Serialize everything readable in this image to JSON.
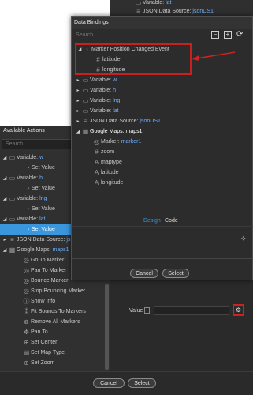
{
  "background": {
    "variable_lat": {
      "label": "Variable:",
      "name": "lat"
    },
    "json_source": {
      "label": "JSON Data Source:",
      "name": "jsonDS1"
    }
  },
  "available_actions": {
    "title": "Available Actions",
    "search_placeholder": "Search",
    "items": [
      {
        "type": "Variable:",
        "name": "w",
        "sub": "Set Value"
      },
      {
        "type": "Variable:",
        "name": "h",
        "sub": "Set Value"
      },
      {
        "type": "Variable:",
        "name": "lng",
        "sub": "Set Value"
      },
      {
        "type": "Variable:",
        "name": "lat",
        "sub": "Set Value"
      }
    ],
    "json_source": {
      "label": "JSON Data Source:",
      "name": "js"
    },
    "maps": {
      "label": "Google Maps:",
      "name": "maps1"
    },
    "map_actions": [
      "Go To Marker",
      "Pan To Marker",
      "Bounce Marker",
      "Stop Bouncing Marker",
      "Show Info",
      "Fit Bounds To Markers",
      "Remove All Markers",
      "Pan To",
      "Set Center",
      "Set Map Type",
      "Set Zoom"
    ]
  },
  "properties": {
    "value_label": "Value"
  },
  "footer": {
    "cancel": "Cancel",
    "select": "Select"
  },
  "data_bindings": {
    "title": "Data Bindings",
    "search_placeholder": "Search",
    "event": {
      "label": "Marker Position Changed Event",
      "fields": [
        "latitude",
        "longitude"
      ]
    },
    "variables": [
      {
        "label": "Variable:",
        "name": "w"
      },
      {
        "label": "Variable:",
        "name": "h"
      },
      {
        "label": "Variable:",
        "name": "lng"
      },
      {
        "label": "Variable:",
        "name": "lat"
      }
    ],
    "json_source": {
      "label": "JSON Data Source:",
      "name": "jsonDS1"
    },
    "maps": {
      "label": "Google Maps:",
      "name": "maps1",
      "marker": {
        "label": "Marker:",
        "name": "marker1"
      },
      "fields": [
        {
          "icon": "#",
          "name": "zoom"
        },
        {
          "icon": "A",
          "name": "maptype"
        },
        {
          "icon": "A",
          "name": "latitude"
        },
        {
          "icon": "A",
          "name": "longitude"
        }
      ]
    },
    "tabs": {
      "design": "Design",
      "code": "Code"
    },
    "cancel": "Cancel",
    "select": "Select"
  },
  "colors": {
    "accent": "#3a96dd",
    "highlight": "#cc1f1f"
  }
}
